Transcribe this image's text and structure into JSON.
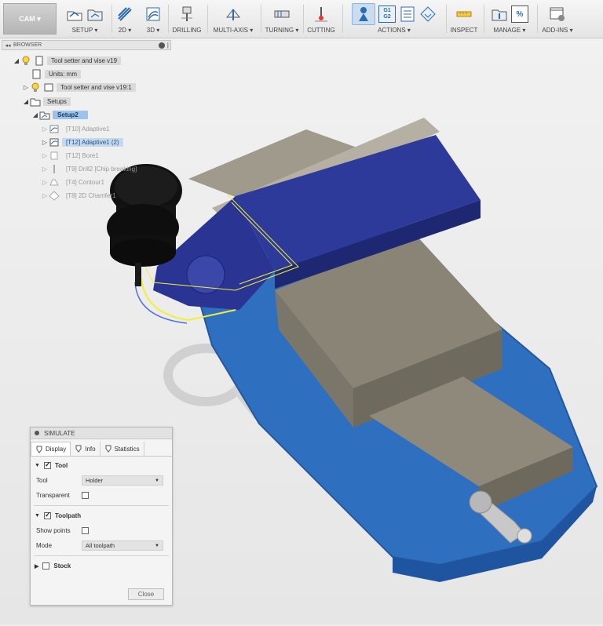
{
  "toolbar": {
    "workspace": "CAM ▾",
    "groups": [
      {
        "label": "SETUP ▾"
      },
      {
        "label": "2D ▾"
      },
      {
        "label": "3D ▾"
      },
      {
        "label": "DRILLING"
      },
      {
        "label": "MULTI-AXIS ▾"
      },
      {
        "label": "TURNING ▾"
      },
      {
        "label": "CUTTING"
      },
      {
        "label": "ACTIONS ▾"
      },
      {
        "label": "INSPECT"
      },
      {
        "label": "MANAGE ▾"
      },
      {
        "label": "ADD-INS ▾"
      }
    ],
    "g1g2_top": "G1",
    "g1g2_bottom": "G2",
    "percent": "%"
  },
  "browser": {
    "header": "BROWSER",
    "root": "Tool setter and vise v19",
    "units": "Units: mm",
    "component": "Tool setter and vise v19:1",
    "setups": "Setups",
    "setup": "Setup2",
    "operations": [
      {
        "label": "[T10] Adaptive1"
      },
      {
        "label": "[T12] Adaptive1 (2)"
      },
      {
        "label": "[T12] Bore1"
      },
      {
        "label": "[T9] Drill2 [Chip breaking]"
      },
      {
        "label": "[T4] Contour1"
      },
      {
        "label": "[T8] 2D Chamfer1"
      }
    ]
  },
  "simulate": {
    "title": "SIMULATE",
    "tabs": [
      "Display",
      "Info",
      "Statistics"
    ],
    "tool_section": "Tool",
    "tool_label": "Tool",
    "tool_value": "Holder",
    "transparent_label": "Transparent",
    "toolpath_section": "Toolpath",
    "show_points_label": "Show points",
    "mode_label": "Mode",
    "mode_value": "All toolpath",
    "stock_section": "Stock",
    "close_label": "Close"
  },
  "colors": {
    "vise_blue": "#2f6fc0",
    "part_purple": "#2d3a9a",
    "jaw_gray": "#8a8476",
    "toolpath_yellow": "#f2ef3a"
  }
}
